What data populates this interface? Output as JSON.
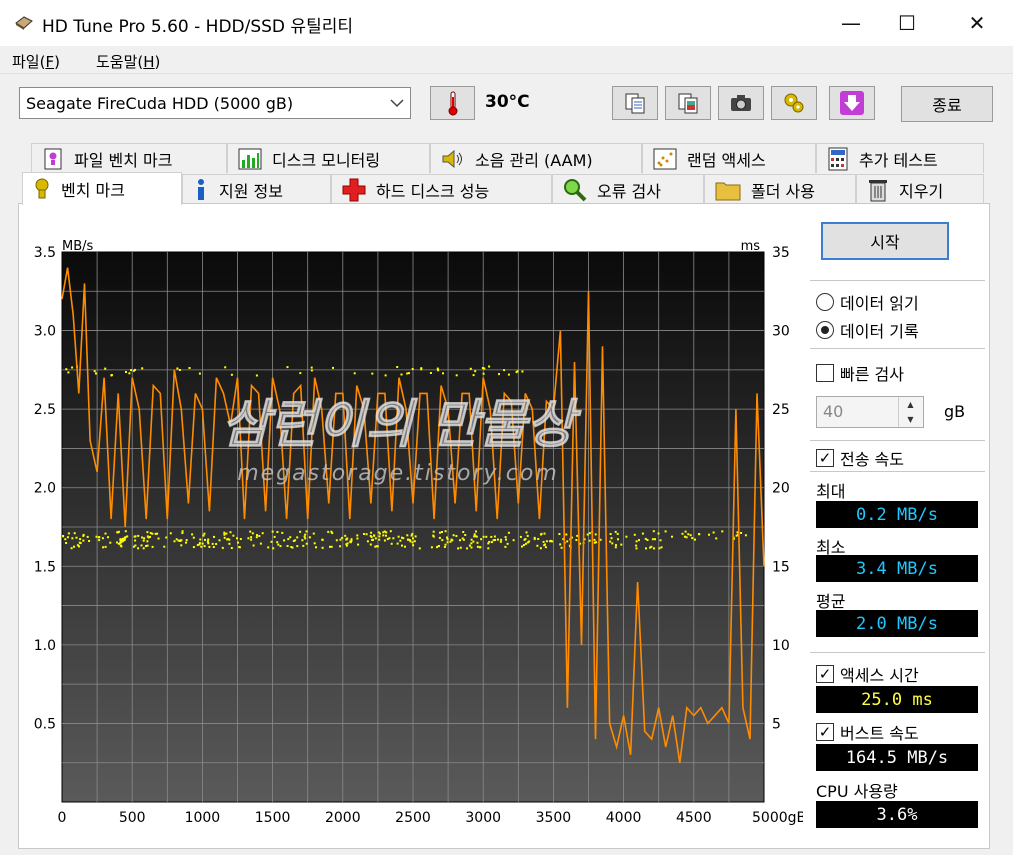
{
  "window": {
    "title": "HD Tune Pro 5.60 - HDD/SSD  유틸리티",
    "minimize": "—",
    "maximize": "☐",
    "close": "✕"
  },
  "menu": [
    {
      "label": "파일(",
      "key": "F",
      "end": ")"
    },
    {
      "label": "도움말(",
      "key": "H",
      "end": ")"
    }
  ],
  "toolbar": {
    "drive": "Seagate FireCuda HDD (5000 gB)",
    "temperature": "30°C",
    "exit_label": "종료"
  },
  "tabs_top": [
    "파일 벤치 마크",
    "디스크 모니터링",
    "소음 관리 (AAM)",
    "랜덤 액세스",
    "추가 테스트"
  ],
  "tabs_bottom": [
    "벤치 마크",
    "지원 정보",
    "하드 디스크 성능",
    "오류 검사",
    "폴더 사용",
    "지우기"
  ],
  "watermark": {
    "main": "삼런이의 만물상",
    "sub": "megastorage.tistory.com"
  },
  "panel": {
    "start_label": "시작",
    "read_label": "데이터 읽기",
    "write_label": "데이터 기록",
    "write_selected": true,
    "quick_scan_label": "빠른 검사",
    "quick_scan_checked": false,
    "size_value": "40",
    "size_unit": "gB",
    "transfer_label": "전송 속도",
    "transfer_checked": true,
    "max_label": "최대",
    "max_value": "0.2 MB/s",
    "min_label": "최소",
    "min_value": "3.4 MB/s",
    "avg_label": "평균",
    "avg_value": "2.0 MB/s",
    "access_label": "액세스 시간",
    "access_checked": true,
    "access_value": "25.0 ms",
    "burst_label": "버스트 속도",
    "burst_checked": true,
    "burst_value": "164.5 MB/s",
    "cpu_label": "CPU 사용량",
    "cpu_value": "3.6%"
  },
  "chart_data": {
    "type": "line",
    "ylabel": "MB/s",
    "y2label": "ms",
    "xunit": "gB",
    "xlim": [
      0,
      5000
    ],
    "ylim": [
      0,
      3.5
    ],
    "y2lim": [
      0,
      35
    ],
    "x_ticks": [
      "0",
      "500",
      "1000",
      "1500",
      "2000",
      "2500",
      "3000",
      "3500",
      "4000",
      "4500",
      "5000gB"
    ],
    "y_ticks": [
      "0.5",
      "1.0",
      "1.5",
      "2.0",
      "2.5",
      "3.0",
      "3.5"
    ],
    "y2_ticks": [
      "5",
      "10",
      "15",
      "20",
      "25",
      "30",
      "35"
    ],
    "grid": true,
    "series": [
      {
        "color": "#ff8c00",
        "x": [
          0,
          40,
          80,
          120,
          160,
          200,
          250,
          300,
          350,
          400,
          450,
          500,
          550,
          600,
          650,
          700,
          750,
          800,
          850,
          900,
          950,
          1000,
          1050,
          1100,
          1150,
          1200,
          1250,
          1300,
          1350,
          1400,
          1450,
          1500,
          1550,
          1600,
          1650,
          1700,
          1750,
          1800,
          1850,
          1900,
          1950,
          2000,
          2050,
          2100,
          2150,
          2200,
          2250,
          2300,
          2350,
          2400,
          2450,
          2500,
          2550,
          2600,
          2650,
          2700,
          2750,
          2800,
          2850,
          2900,
          2950,
          3000,
          3050,
          3100,
          3150,
          3200,
          3250,
          3300,
          3350,
          3400,
          3450,
          3500,
          3550,
          3600,
          3650,
          3700,
          3750,
          3800,
          3850,
          3900,
          3950,
          4000,
          4050,
          4100,
          4150,
          4200,
          4250,
          4300,
          4350,
          4400,
          4450,
          4500,
          4550,
          4600,
          4650,
          4700,
          4750,
          4800,
          4850,
          4900,
          4950,
          5000
        ],
        "y": [
          3.2,
          3.4,
          3.1,
          2.6,
          3.3,
          2.3,
          2.1,
          2.7,
          1.8,
          2.6,
          1.75,
          2.7,
          2.5,
          1.8,
          2.65,
          2.6,
          1.8,
          2.75,
          2.5,
          1.9,
          2.6,
          2.5,
          1.85,
          2.7,
          2.6,
          2.4,
          2.7,
          1.8,
          2.65,
          2.6,
          1.85,
          2.7,
          2.5,
          1.8,
          2.6,
          2.65,
          1.8,
          2.7,
          2.5,
          1.9,
          2.6,
          2.6,
          1.8,
          2.65,
          2.5,
          1.9,
          2.6,
          2.6,
          1.85,
          2.7,
          2.5,
          1.9,
          2.6,
          2.6,
          1.8,
          2.65,
          2.5,
          1.9,
          2.6,
          2.6,
          1.85,
          2.7,
          2.5,
          1.8,
          2.6,
          2.55,
          1.9,
          2.6,
          2.5,
          1.8,
          2.55,
          2.5,
          3.0,
          0.6,
          2.8,
          1.0,
          3.25,
          0.4,
          2.9,
          0.5,
          0.35,
          0.55,
          0.3,
          1.4,
          0.45,
          0.4,
          0.6,
          0.35,
          0.55,
          0.25,
          0.6,
          0.55,
          0.6,
          0.5,
          0.55,
          0.6,
          0.5,
          2.5,
          0.6,
          0.4,
          2.6,
          1.5
        ]
      }
    ],
    "access_time_ms": {
      "color": "#ffff00",
      "bands": [
        17,
        16.5,
        27.5
      ]
    }
  }
}
